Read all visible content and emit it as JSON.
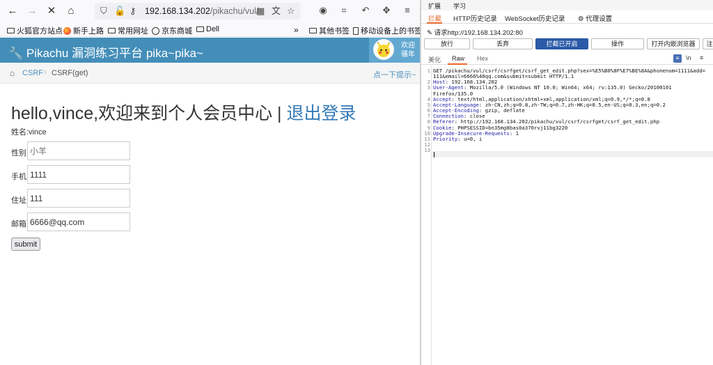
{
  "browser": {
    "url_host": "192.168.134.202",
    "url_path": "/pikachu/vul/",
    "bookmarks": [
      "火狐官方站点",
      "新手上路",
      "常用网址",
      "京东商城",
      "Dell",
      "其他书签",
      "移动设备上的书签"
    ]
  },
  "page": {
    "brand": "Pikachu 漏洞练习平台 pika~pika~",
    "user_greeting": [
      "欢迎",
      "骚年"
    ],
    "breadcrumb": {
      "section": "CSRF",
      "current": "CSRF(get)",
      "tip": "点一下提示~"
    },
    "title": "hello,vince,欢迎来到个人会员中心 | ",
    "logout": "退出登录",
    "name_line": "姓名:vince",
    "form": {
      "sex_label": "性别:",
      "sex_placeholder": "小羊",
      "phone_label": "手机:",
      "phone_value": "1111",
      "addr_label": "住址:",
      "addr_value": "111",
      "email_label": "邮箱:",
      "email_value": "6666@qq.com",
      "submit": "submit"
    }
  },
  "burp": {
    "top_menu": [
      "扩展",
      "学习"
    ],
    "tabs": [
      "拦截",
      "HTTP历史记录",
      "WebSocket历史记录",
      "代理设置"
    ],
    "request_to": "请求http://192.168.134.202:80",
    "buttons": [
      "放行",
      "丢弃",
      "拦截已开启",
      "操作",
      "打开内嵌浏览器",
      "注"
    ],
    "view_tabs": [
      "美化",
      "Raw",
      "Hex"
    ],
    "newline_toggle": "\\n",
    "request_lines": [
      {
        "n": "1",
        "text": "GET /pikachu/vul/csrf/csrfget/csrf_get_edit.php?sex=%E5%B0%8F%E7%BE%8A&phonenum=1111&add="
      },
      {
        "n": "",
        "text": "111&email=6666%40qq.com&submit=submit HTTP/1.1"
      },
      {
        "n": "2",
        "key": "Host",
        "val": " 192.168.134.202"
      },
      {
        "n": "3",
        "key": "User-Agent",
        "val": " Mozilla/5.0 (Windows NT 10.0; Win64; x64; rv:135.0) Gecko/20100101"
      },
      {
        "n": "",
        "text": "Firefox/135.0"
      },
      {
        "n": "4",
        "key": "Accept",
        "val": " text/html,application/xhtml+xml,application/xml;q=0.9,*/*;q=0.8"
      },
      {
        "n": "5",
        "key": "Accept-Language",
        "val": " zh-CN,zh;q=0.8,zh-TW;q=0.7,zh-HK;q=0.5,en-US;q=0.3,en;q=0.2"
      },
      {
        "n": "6",
        "key": "Accept-Encoding",
        "val": " gzip, deflate"
      },
      {
        "n": "7",
        "key": "Connection",
        "val": " close"
      },
      {
        "n": "8",
        "key": "Referer",
        "val": " http://192.168.134.202/pikachu/vul/csrf/csrfget/csrf_get_edit.php"
      },
      {
        "n": "9",
        "key": "Cookie",
        "val": " PHPSESSID=bn35mg8bas0a370rvj11bg3220"
      },
      {
        "n": "10",
        "key": "Upgrade-Insecure-Requests",
        "val": " 1"
      },
      {
        "n": "11",
        "key": "Priority",
        "val": " u=0, i"
      },
      {
        "n": "12",
        "text": ""
      },
      {
        "n": "13",
        "text": ""
      }
    ]
  }
}
